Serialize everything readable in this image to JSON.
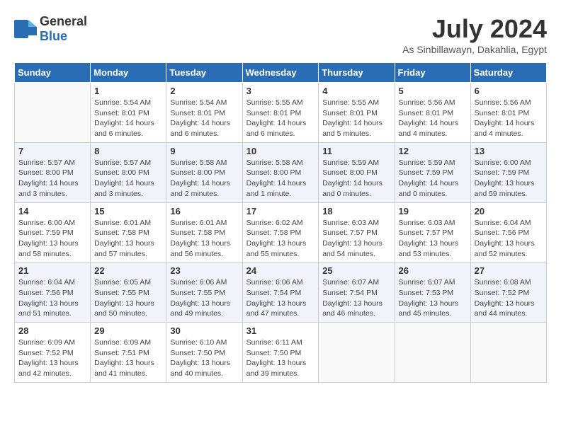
{
  "header": {
    "logo_general": "General",
    "logo_blue": "Blue",
    "month_title": "July 2024",
    "location": "As Sinbillawayn, Dakahlia, Egypt"
  },
  "days_of_week": [
    "Sunday",
    "Monday",
    "Tuesday",
    "Wednesday",
    "Thursday",
    "Friday",
    "Saturday"
  ],
  "weeks": [
    [
      {
        "day": "",
        "info": ""
      },
      {
        "day": "1",
        "info": "Sunrise: 5:54 AM\nSunset: 8:01 PM\nDaylight: 14 hours\nand 6 minutes."
      },
      {
        "day": "2",
        "info": "Sunrise: 5:54 AM\nSunset: 8:01 PM\nDaylight: 14 hours\nand 6 minutes."
      },
      {
        "day": "3",
        "info": "Sunrise: 5:55 AM\nSunset: 8:01 PM\nDaylight: 14 hours\nand 6 minutes."
      },
      {
        "day": "4",
        "info": "Sunrise: 5:55 AM\nSunset: 8:01 PM\nDaylight: 14 hours\nand 5 minutes."
      },
      {
        "day": "5",
        "info": "Sunrise: 5:56 AM\nSunset: 8:01 PM\nDaylight: 14 hours\nand 4 minutes."
      },
      {
        "day": "6",
        "info": "Sunrise: 5:56 AM\nSunset: 8:01 PM\nDaylight: 14 hours\nand 4 minutes."
      }
    ],
    [
      {
        "day": "7",
        "info": "Sunrise: 5:57 AM\nSunset: 8:00 PM\nDaylight: 14 hours\nand 3 minutes."
      },
      {
        "day": "8",
        "info": "Sunrise: 5:57 AM\nSunset: 8:00 PM\nDaylight: 14 hours\nand 3 minutes."
      },
      {
        "day": "9",
        "info": "Sunrise: 5:58 AM\nSunset: 8:00 PM\nDaylight: 14 hours\nand 2 minutes."
      },
      {
        "day": "10",
        "info": "Sunrise: 5:58 AM\nSunset: 8:00 PM\nDaylight: 14 hours\nand 1 minute."
      },
      {
        "day": "11",
        "info": "Sunrise: 5:59 AM\nSunset: 8:00 PM\nDaylight: 14 hours\nand 0 minutes."
      },
      {
        "day": "12",
        "info": "Sunrise: 5:59 AM\nSunset: 7:59 PM\nDaylight: 14 hours\nand 0 minutes."
      },
      {
        "day": "13",
        "info": "Sunrise: 6:00 AM\nSunset: 7:59 PM\nDaylight: 13 hours\nand 59 minutes."
      }
    ],
    [
      {
        "day": "14",
        "info": "Sunrise: 6:00 AM\nSunset: 7:59 PM\nDaylight: 13 hours\nand 58 minutes."
      },
      {
        "day": "15",
        "info": "Sunrise: 6:01 AM\nSunset: 7:58 PM\nDaylight: 13 hours\nand 57 minutes."
      },
      {
        "day": "16",
        "info": "Sunrise: 6:01 AM\nSunset: 7:58 PM\nDaylight: 13 hours\nand 56 minutes."
      },
      {
        "day": "17",
        "info": "Sunrise: 6:02 AM\nSunset: 7:58 PM\nDaylight: 13 hours\nand 55 minutes."
      },
      {
        "day": "18",
        "info": "Sunrise: 6:03 AM\nSunset: 7:57 PM\nDaylight: 13 hours\nand 54 minutes."
      },
      {
        "day": "19",
        "info": "Sunrise: 6:03 AM\nSunset: 7:57 PM\nDaylight: 13 hours\nand 53 minutes."
      },
      {
        "day": "20",
        "info": "Sunrise: 6:04 AM\nSunset: 7:56 PM\nDaylight: 13 hours\nand 52 minutes."
      }
    ],
    [
      {
        "day": "21",
        "info": "Sunrise: 6:04 AM\nSunset: 7:56 PM\nDaylight: 13 hours\nand 51 minutes."
      },
      {
        "day": "22",
        "info": "Sunrise: 6:05 AM\nSunset: 7:55 PM\nDaylight: 13 hours\nand 50 minutes."
      },
      {
        "day": "23",
        "info": "Sunrise: 6:06 AM\nSunset: 7:55 PM\nDaylight: 13 hours\nand 49 minutes."
      },
      {
        "day": "24",
        "info": "Sunrise: 6:06 AM\nSunset: 7:54 PM\nDaylight: 13 hours\nand 47 minutes."
      },
      {
        "day": "25",
        "info": "Sunrise: 6:07 AM\nSunset: 7:54 PM\nDaylight: 13 hours\nand 46 minutes."
      },
      {
        "day": "26",
        "info": "Sunrise: 6:07 AM\nSunset: 7:53 PM\nDaylight: 13 hours\nand 45 minutes."
      },
      {
        "day": "27",
        "info": "Sunrise: 6:08 AM\nSunset: 7:52 PM\nDaylight: 13 hours\nand 44 minutes."
      }
    ],
    [
      {
        "day": "28",
        "info": "Sunrise: 6:09 AM\nSunset: 7:52 PM\nDaylight: 13 hours\nand 42 minutes."
      },
      {
        "day": "29",
        "info": "Sunrise: 6:09 AM\nSunset: 7:51 PM\nDaylight: 13 hours\nand 41 minutes."
      },
      {
        "day": "30",
        "info": "Sunrise: 6:10 AM\nSunset: 7:50 PM\nDaylight: 13 hours\nand 40 minutes."
      },
      {
        "day": "31",
        "info": "Sunrise: 6:11 AM\nSunset: 7:50 PM\nDaylight: 13 hours\nand 39 minutes."
      },
      {
        "day": "",
        "info": ""
      },
      {
        "day": "",
        "info": ""
      },
      {
        "day": "",
        "info": ""
      }
    ]
  ]
}
